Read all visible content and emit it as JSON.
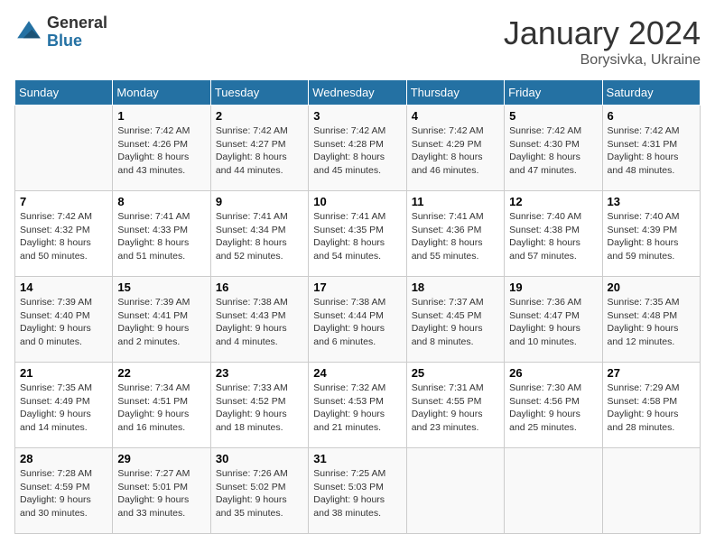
{
  "header": {
    "logo_general": "General",
    "logo_blue": "Blue",
    "month": "January 2024",
    "location": "Borysivka, Ukraine"
  },
  "days_of_week": [
    "Sunday",
    "Monday",
    "Tuesday",
    "Wednesday",
    "Thursday",
    "Friday",
    "Saturday"
  ],
  "weeks": [
    [
      {
        "day": "",
        "lines": []
      },
      {
        "day": "1",
        "lines": [
          "Sunrise: 7:42 AM",
          "Sunset: 4:26 PM",
          "Daylight: 8 hours",
          "and 43 minutes."
        ]
      },
      {
        "day": "2",
        "lines": [
          "Sunrise: 7:42 AM",
          "Sunset: 4:27 PM",
          "Daylight: 8 hours",
          "and 44 minutes."
        ]
      },
      {
        "day": "3",
        "lines": [
          "Sunrise: 7:42 AM",
          "Sunset: 4:28 PM",
          "Daylight: 8 hours",
          "and 45 minutes."
        ]
      },
      {
        "day": "4",
        "lines": [
          "Sunrise: 7:42 AM",
          "Sunset: 4:29 PM",
          "Daylight: 8 hours",
          "and 46 minutes."
        ]
      },
      {
        "day": "5",
        "lines": [
          "Sunrise: 7:42 AM",
          "Sunset: 4:30 PM",
          "Daylight: 8 hours",
          "and 47 minutes."
        ]
      },
      {
        "day": "6",
        "lines": [
          "Sunrise: 7:42 AM",
          "Sunset: 4:31 PM",
          "Daylight: 8 hours",
          "and 48 minutes."
        ]
      }
    ],
    [
      {
        "day": "7",
        "lines": [
          "Sunrise: 7:42 AM",
          "Sunset: 4:32 PM",
          "Daylight: 8 hours",
          "and 50 minutes."
        ]
      },
      {
        "day": "8",
        "lines": [
          "Sunrise: 7:41 AM",
          "Sunset: 4:33 PM",
          "Daylight: 8 hours",
          "and 51 minutes."
        ]
      },
      {
        "day": "9",
        "lines": [
          "Sunrise: 7:41 AM",
          "Sunset: 4:34 PM",
          "Daylight: 8 hours",
          "and 52 minutes."
        ]
      },
      {
        "day": "10",
        "lines": [
          "Sunrise: 7:41 AM",
          "Sunset: 4:35 PM",
          "Daylight: 8 hours",
          "and 54 minutes."
        ]
      },
      {
        "day": "11",
        "lines": [
          "Sunrise: 7:41 AM",
          "Sunset: 4:36 PM",
          "Daylight: 8 hours",
          "and 55 minutes."
        ]
      },
      {
        "day": "12",
        "lines": [
          "Sunrise: 7:40 AM",
          "Sunset: 4:38 PM",
          "Daylight: 8 hours",
          "and 57 minutes."
        ]
      },
      {
        "day": "13",
        "lines": [
          "Sunrise: 7:40 AM",
          "Sunset: 4:39 PM",
          "Daylight: 8 hours",
          "and 59 minutes."
        ]
      }
    ],
    [
      {
        "day": "14",
        "lines": [
          "Sunrise: 7:39 AM",
          "Sunset: 4:40 PM",
          "Daylight: 9 hours",
          "and 0 minutes."
        ]
      },
      {
        "day": "15",
        "lines": [
          "Sunrise: 7:39 AM",
          "Sunset: 4:41 PM",
          "Daylight: 9 hours",
          "and 2 minutes."
        ]
      },
      {
        "day": "16",
        "lines": [
          "Sunrise: 7:38 AM",
          "Sunset: 4:43 PM",
          "Daylight: 9 hours",
          "and 4 minutes."
        ]
      },
      {
        "day": "17",
        "lines": [
          "Sunrise: 7:38 AM",
          "Sunset: 4:44 PM",
          "Daylight: 9 hours",
          "and 6 minutes."
        ]
      },
      {
        "day": "18",
        "lines": [
          "Sunrise: 7:37 AM",
          "Sunset: 4:45 PM",
          "Daylight: 9 hours",
          "and 8 minutes."
        ]
      },
      {
        "day": "19",
        "lines": [
          "Sunrise: 7:36 AM",
          "Sunset: 4:47 PM",
          "Daylight: 9 hours",
          "and 10 minutes."
        ]
      },
      {
        "day": "20",
        "lines": [
          "Sunrise: 7:35 AM",
          "Sunset: 4:48 PM",
          "Daylight: 9 hours",
          "and 12 minutes."
        ]
      }
    ],
    [
      {
        "day": "21",
        "lines": [
          "Sunrise: 7:35 AM",
          "Sunset: 4:49 PM",
          "Daylight: 9 hours",
          "and 14 minutes."
        ]
      },
      {
        "day": "22",
        "lines": [
          "Sunrise: 7:34 AM",
          "Sunset: 4:51 PM",
          "Daylight: 9 hours",
          "and 16 minutes."
        ]
      },
      {
        "day": "23",
        "lines": [
          "Sunrise: 7:33 AM",
          "Sunset: 4:52 PM",
          "Daylight: 9 hours",
          "and 18 minutes."
        ]
      },
      {
        "day": "24",
        "lines": [
          "Sunrise: 7:32 AM",
          "Sunset: 4:53 PM",
          "Daylight: 9 hours",
          "and 21 minutes."
        ]
      },
      {
        "day": "25",
        "lines": [
          "Sunrise: 7:31 AM",
          "Sunset: 4:55 PM",
          "Daylight: 9 hours",
          "and 23 minutes."
        ]
      },
      {
        "day": "26",
        "lines": [
          "Sunrise: 7:30 AM",
          "Sunset: 4:56 PM",
          "Daylight: 9 hours",
          "and 25 minutes."
        ]
      },
      {
        "day": "27",
        "lines": [
          "Sunrise: 7:29 AM",
          "Sunset: 4:58 PM",
          "Daylight: 9 hours",
          "and 28 minutes."
        ]
      }
    ],
    [
      {
        "day": "28",
        "lines": [
          "Sunrise: 7:28 AM",
          "Sunset: 4:59 PM",
          "Daylight: 9 hours",
          "and 30 minutes."
        ]
      },
      {
        "day": "29",
        "lines": [
          "Sunrise: 7:27 AM",
          "Sunset: 5:01 PM",
          "Daylight: 9 hours",
          "and 33 minutes."
        ]
      },
      {
        "day": "30",
        "lines": [
          "Sunrise: 7:26 AM",
          "Sunset: 5:02 PM",
          "Daylight: 9 hours",
          "and 35 minutes."
        ]
      },
      {
        "day": "31",
        "lines": [
          "Sunrise: 7:25 AM",
          "Sunset: 5:03 PM",
          "Daylight: 9 hours",
          "and 38 minutes."
        ]
      },
      {
        "day": "",
        "lines": []
      },
      {
        "day": "",
        "lines": []
      },
      {
        "day": "",
        "lines": []
      }
    ]
  ]
}
